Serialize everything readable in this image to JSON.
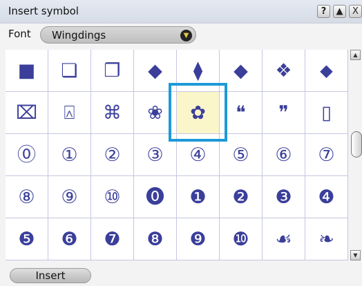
{
  "window": {
    "title": "Insert symbol",
    "help_label": "?",
    "minimize_label": "▲",
    "close_label": "X"
  },
  "font": {
    "label": "Font",
    "value": "Wingdings",
    "arrow": "▼"
  },
  "symbols": [
    {
      "char": "■",
      "name": "square-frame"
    },
    {
      "char": "❏",
      "name": "shadowed-square-right"
    },
    {
      "char": "❐",
      "name": "shadowed-square-left"
    },
    {
      "char": "◆",
      "name": "small-diamond"
    },
    {
      "char": "⧫",
      "name": "medium-diamond"
    },
    {
      "char": "◆",
      "name": "large-diamond"
    },
    {
      "char": "❖",
      "name": "four-diamonds"
    },
    {
      "char": "⬥",
      "name": "tiny-diamond"
    },
    {
      "char": "⌧",
      "name": "boxed-x"
    },
    {
      "char": "⍓",
      "name": "boxed-caret"
    },
    {
      "char": "⌘",
      "name": "command-key"
    },
    {
      "char": "❀",
      "name": "outlined-flower"
    },
    {
      "char": "✿",
      "name": "filled-flower"
    },
    {
      "char": "❝",
      "name": "open-quote"
    },
    {
      "char": "❞",
      "name": "close-quote"
    },
    {
      "char": "▯",
      "name": "empty-rectangle"
    },
    {
      "char": "⓪",
      "name": "circled-0"
    },
    {
      "char": "①",
      "name": "circled-1"
    },
    {
      "char": "②",
      "name": "circled-2"
    },
    {
      "char": "③",
      "name": "circled-3"
    },
    {
      "char": "④",
      "name": "circled-4"
    },
    {
      "char": "⑤",
      "name": "circled-5"
    },
    {
      "char": "⑥",
      "name": "circled-6"
    },
    {
      "char": "⑦",
      "name": "circled-7"
    },
    {
      "char": "⑧",
      "name": "circled-8"
    },
    {
      "char": "⑨",
      "name": "circled-9"
    },
    {
      "char": "⑩",
      "name": "circled-10"
    },
    {
      "char": "⓿",
      "name": "negative-circled-0"
    },
    {
      "char": "❶",
      "name": "negative-circled-1"
    },
    {
      "char": "❷",
      "name": "negative-circled-2"
    },
    {
      "char": "❸",
      "name": "negative-circled-3"
    },
    {
      "char": "❹",
      "name": "negative-circled-4"
    },
    {
      "char": "❺",
      "name": "negative-circled-5"
    },
    {
      "char": "❻",
      "name": "negative-circled-6"
    },
    {
      "char": "❼",
      "name": "negative-circled-7"
    },
    {
      "char": "❽",
      "name": "negative-circled-8"
    },
    {
      "char": "❾",
      "name": "negative-circled-9"
    },
    {
      "char": "❿",
      "name": "negative-circled-10"
    },
    {
      "char": "☙",
      "name": "floral-ornament-left"
    },
    {
      "char": "❧",
      "name": "floral-ornament-right"
    }
  ],
  "selected_index": 12,
  "insert_button": "Insert"
}
